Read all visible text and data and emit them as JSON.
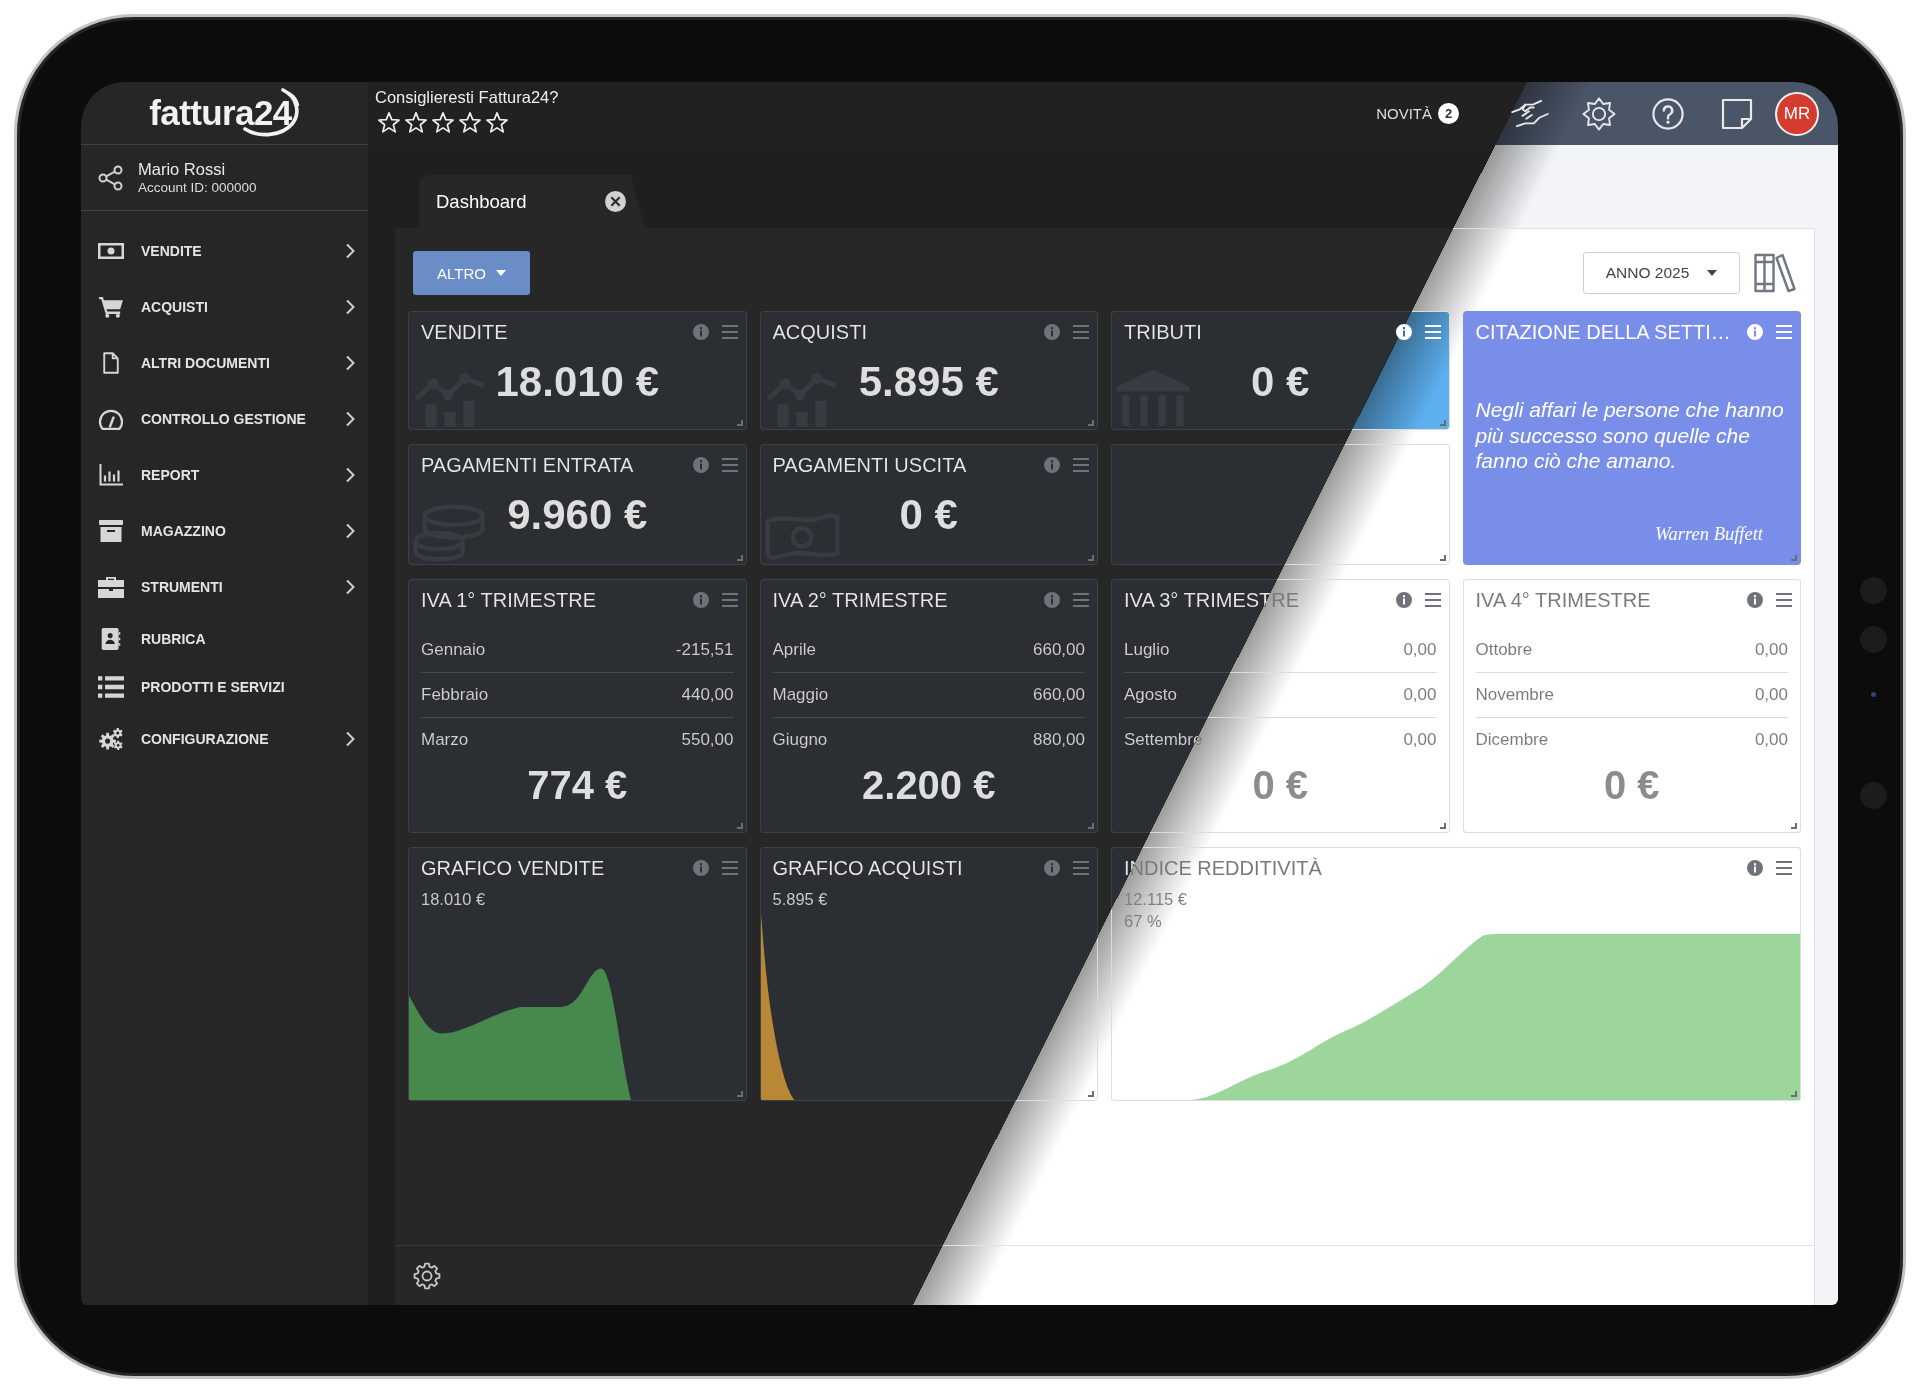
{
  "logo": {
    "text": "fattura24"
  },
  "user": {
    "name": "Mario Rossi",
    "account": "Account ID: 000000"
  },
  "sidebar": {
    "items": [
      {
        "label": "VENDITE",
        "has_submenu": true
      },
      {
        "label": "ACQUISTI",
        "has_submenu": true
      },
      {
        "label": "ALTRI DOCUMENTI",
        "has_submenu": true
      },
      {
        "label": "CONTROLLO GESTIONE",
        "has_submenu": true
      },
      {
        "label": "REPORT",
        "has_submenu": true
      },
      {
        "label": "MAGAZZINO",
        "has_submenu": true
      },
      {
        "label": "STRUMENTI",
        "has_submenu": true
      },
      {
        "label": "RUBRICA",
        "has_submenu": false
      },
      {
        "label": "PRODOTTI E SERVIZI",
        "has_submenu": false
      },
      {
        "label": "CONFIGURAZIONE",
        "has_submenu": true
      }
    ]
  },
  "topbar": {
    "rating": {
      "question": "Consiglieresti Fattura24?",
      "stars": 0
    },
    "news": {
      "label": "NOVITÀ",
      "count": "2"
    },
    "avatar": {
      "initials": "MR"
    }
  },
  "tabs": [
    {
      "label": "Dashboard",
      "selected": true
    }
  ],
  "toolbar": {
    "filter_button": "ALTRO",
    "year_select": "ANNO 2025"
  },
  "widgets": [
    {
      "kind": "stat",
      "title": "VENDITE",
      "value": "18.010 €"
    },
    {
      "kind": "stat",
      "title": "ACQUISTI",
      "value": "5.895 €"
    },
    {
      "kind": "stat",
      "title": "TRIBUTI",
      "value": "0 €",
      "color": "#5cb0ee"
    },
    {
      "kind": "quote",
      "title": "CITAZIONE DELLA SETTI…",
      "quote": "Negli affari le persone che hanno più successo sono quelle che fanno ciò che amano.",
      "author": "Warren Buffett",
      "color": "#798ee8"
    },
    {
      "kind": "stat",
      "title": "PAGAMENTI ENTRATA",
      "value": "9.960 €"
    },
    {
      "kind": "stat",
      "title": "PAGAMENTI USCITA",
      "value": "0 €"
    },
    {
      "kind": "empty"
    },
    {
      "kind": "vat",
      "title": "IVA 1° TRIMESTRE",
      "rows": [
        {
          "month": "Gennaio",
          "amount": "-215,51"
        },
        {
          "month": "Febbraio",
          "amount": "440,00"
        },
        {
          "month": "Marzo",
          "amount": "550,00"
        }
      ],
      "total": "774 €"
    },
    {
      "kind": "vat",
      "title": "IVA 2° TRIMESTRE",
      "rows": [
        {
          "month": "Aprile",
          "amount": "660,00"
        },
        {
          "month": "Maggio",
          "amount": "660,00"
        },
        {
          "month": "Giugno",
          "amount": "880,00"
        }
      ],
      "total": "2.200 €"
    },
    {
      "kind": "vat",
      "title": "IVA 3° TRIMESTRE",
      "rows": [
        {
          "month": "Luglio",
          "amount": "0,00"
        },
        {
          "month": "Agosto",
          "amount": "0,00"
        },
        {
          "month": "Settembre",
          "amount": "0,00"
        }
      ],
      "total": "0 €"
    },
    {
      "kind": "vat",
      "title": "IVA 4° TRIMESTRE",
      "rows": [
        {
          "month": "Ottobre",
          "amount": "0,00"
        },
        {
          "month": "Novembre",
          "amount": "0,00"
        },
        {
          "month": "Dicembre",
          "amount": "0,00"
        }
      ],
      "total": "0 €"
    },
    {
      "kind": "chart",
      "title": "GRAFICO VENDITE",
      "figures": [
        "18.010 €"
      ],
      "color": "#47894c"
    },
    {
      "kind": "chart",
      "title": "GRAFICO ACQUISTI",
      "figures": [
        "5.895 €"
      ],
      "color": "#b98837"
    },
    {
      "kind": "chart",
      "title": "INDICE REDDITIVITÀ",
      "figures": [
        "12.115 €",
        "67 %"
      ],
      "color": "#9cd69b"
    }
  ]
}
